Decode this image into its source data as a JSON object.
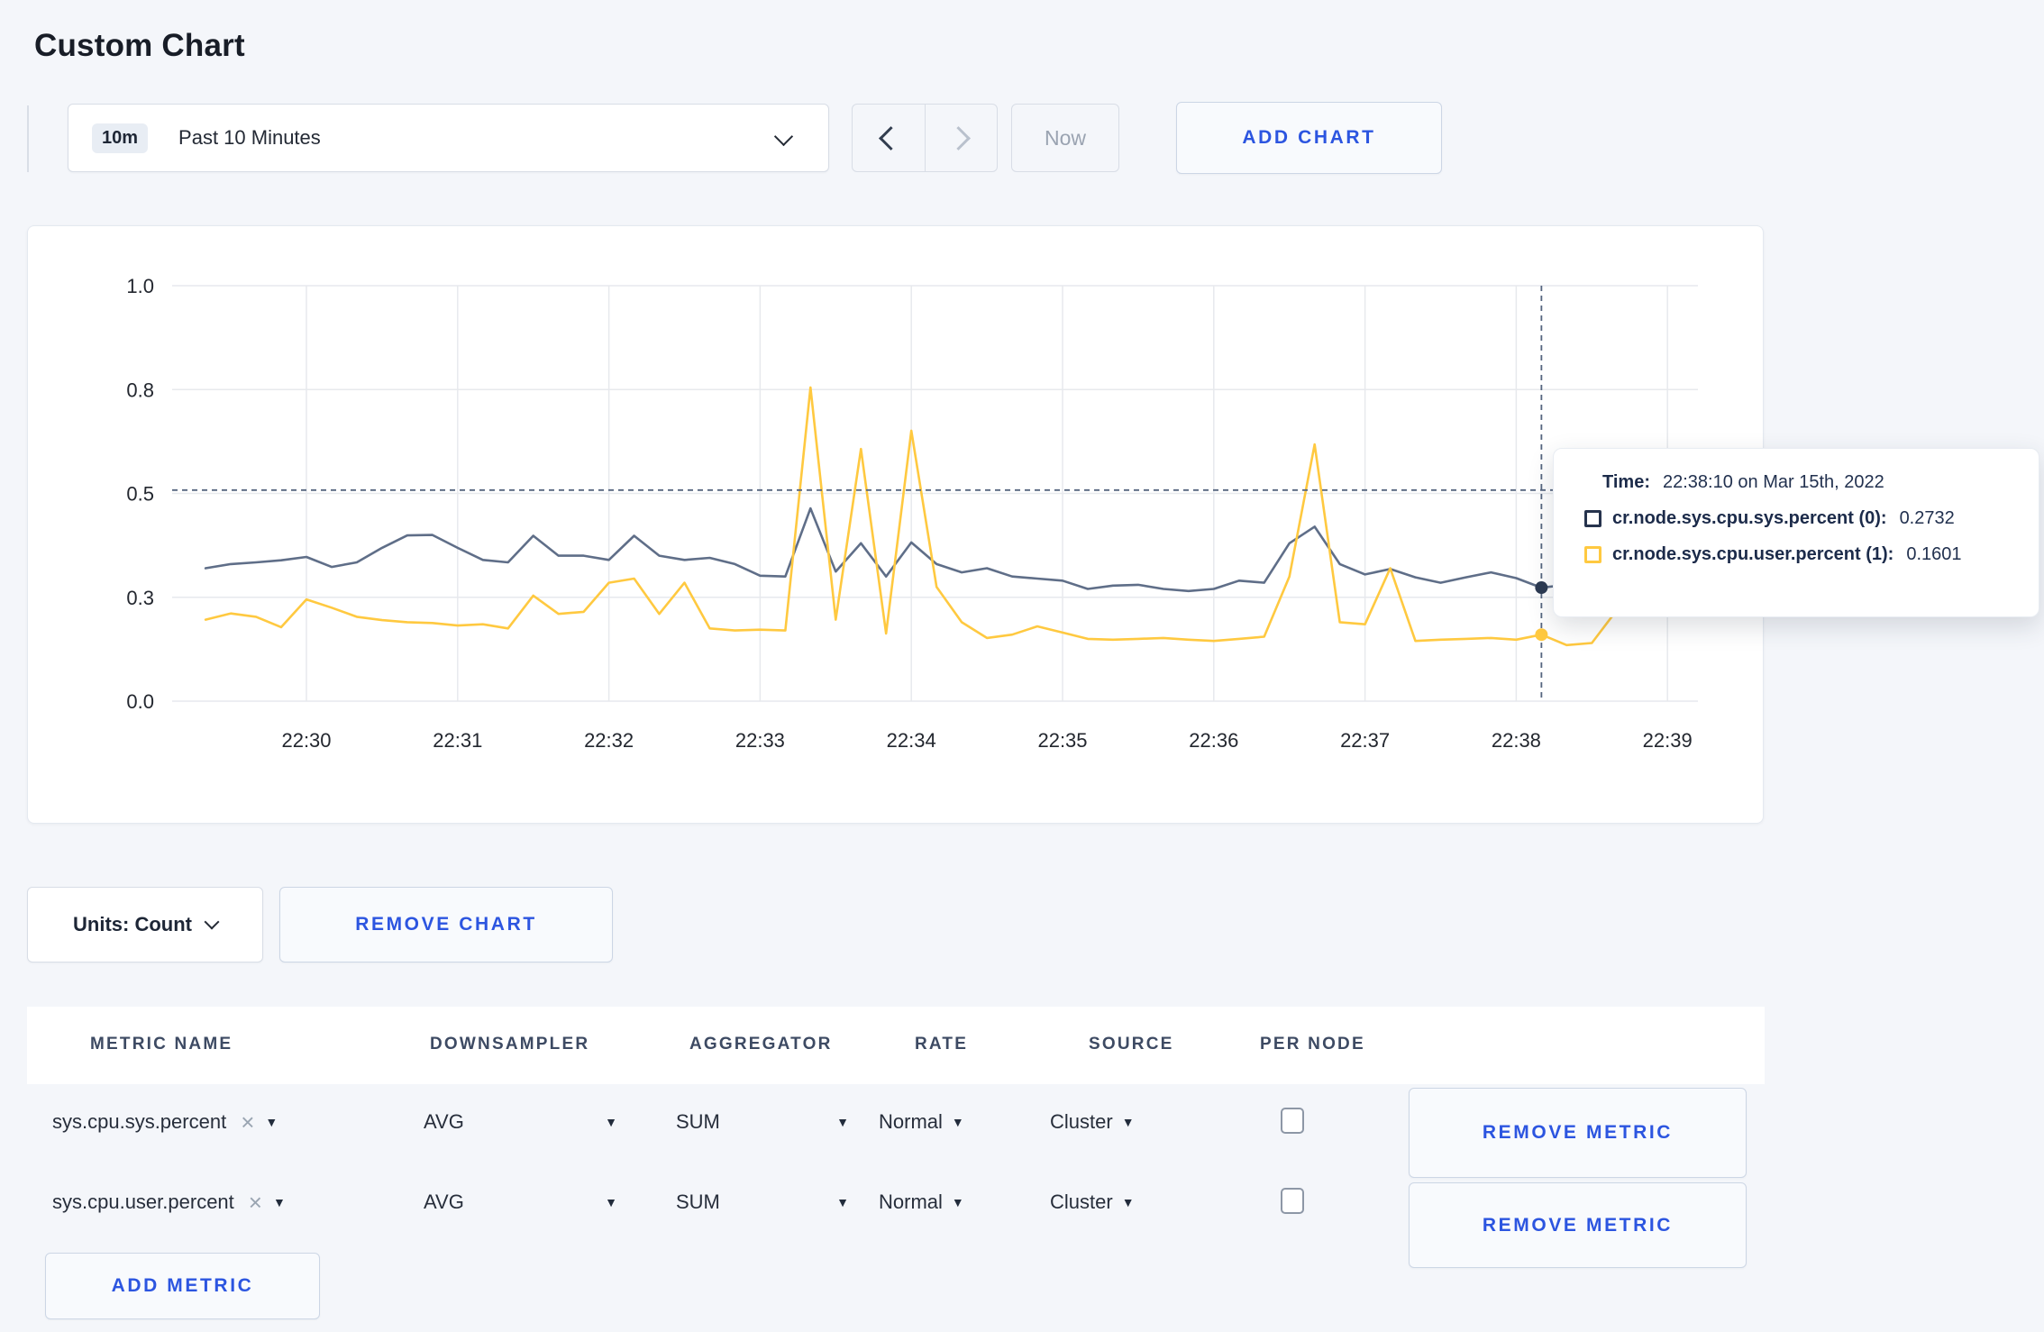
{
  "page": {
    "title": "Custom Chart",
    "background": "#f4f6fa",
    "accent_blue": "#2c55e0"
  },
  "icons": {
    "clear": "×",
    "caret": "▼"
  },
  "toolbar": {
    "time_range": {
      "badge": "10m",
      "label": "Past 10 Minutes"
    },
    "prev_icon": "chevron-left-icon",
    "next_icon": "chevron-right-icon",
    "now_label": "Now",
    "add_chart_label": "ADD CHART"
  },
  "chart_data": {
    "type": "line",
    "title": "",
    "grid": true,
    "ylim": [
      0,
      1
    ],
    "ytick_labels": [
      "0.0",
      "0.3",
      "0.5",
      "0.8",
      "1.0"
    ],
    "ytick_values": [
      0,
      0.25,
      0.5,
      0.75,
      1.0
    ],
    "xticks": [
      "22:30",
      "22:31",
      "22:32",
      "22:33",
      "22:34",
      "22:35",
      "22:36",
      "22:37",
      "22:38",
      "22:39"
    ],
    "x": [
      "22:29:20",
      "22:29:30",
      "22:29:40",
      "22:29:50",
      "22:30:00",
      "22:30:10",
      "22:30:20",
      "22:30:30",
      "22:30:40",
      "22:30:50",
      "22:31:00",
      "22:31:10",
      "22:31:20",
      "22:31:30",
      "22:31:40",
      "22:31:50",
      "22:32:00",
      "22:32:10",
      "22:32:20",
      "22:32:30",
      "22:32:40",
      "22:32:50",
      "22:33:00",
      "22:33:10",
      "22:33:20",
      "22:33:30",
      "22:33:40",
      "22:33:50",
      "22:34:00",
      "22:34:10",
      "22:34:20",
      "22:34:30",
      "22:34:40",
      "22:34:50",
      "22:35:00",
      "22:35:10",
      "22:35:20",
      "22:35:30",
      "22:35:40",
      "22:35:50",
      "22:36:00",
      "22:36:10",
      "22:36:20",
      "22:36:30",
      "22:36:40",
      "22:36:50",
      "22:37:00",
      "22:37:10",
      "22:37:20",
      "22:37:30",
      "22:37:40",
      "22:37:50",
      "22:38:00",
      "22:38:10",
      "22:38:20",
      "22:38:30",
      "22:38:40",
      "22:38:50",
      "22:39:00",
      "22:39:10"
    ],
    "series": [
      {
        "name": "cr.node.sys.cpu.sys.percent",
        "color": "#5f6e88",
        "point_color": "#2c3a52",
        "values": [
          0.32,
          0.33,
          0.334,
          0.339,
          0.347,
          0.323,
          0.334,
          0.369,
          0.399,
          0.4,
          0.369,
          0.34,
          0.334,
          0.398,
          0.35,
          0.35,
          0.34,
          0.398,
          0.35,
          0.34,
          0.345,
          0.33,
          0.302,
          0.3,
          0.464,
          0.312,
          0.38,
          0.3,
          0.382,
          0.33,
          0.31,
          0.32,
          0.3,
          0.295,
          0.29,
          0.27,
          0.278,
          0.28,
          0.27,
          0.265,
          0.27,
          0.29,
          0.285,
          0.38,
          0.42,
          0.33,
          0.305,
          0.318,
          0.298,
          0.285,
          0.298,
          0.31,
          0.296,
          0.2732,
          0.28,
          0.285,
          0.28,
          0.3,
          0.285,
          0.29
        ]
      },
      {
        "name": "cr.node.sys.cpu.user.percent",
        "color": "#ffc940",
        "point_color": "#ffc940",
        "values": [
          0.196,
          0.211,
          0.203,
          0.178,
          0.245,
          0.225,
          0.203,
          0.195,
          0.19,
          0.188,
          0.182,
          0.185,
          0.175,
          0.254,
          0.21,
          0.215,
          0.285,
          0.295,
          0.21,
          0.285,
          0.175,
          0.17,
          0.172,
          0.17,
          0.755,
          0.196,
          0.607,
          0.163,
          0.651,
          0.275,
          0.19,
          0.152,
          0.16,
          0.18,
          0.165,
          0.15,
          0.148,
          0.15,
          0.152,
          0.148,
          0.145,
          0.15,
          0.155,
          0.3,
          0.618,
          0.19,
          0.185,
          0.32,
          0.145,
          0.148,
          0.15,
          0.152,
          0.148,
          0.1601,
          0.135,
          0.14,
          0.22,
          0.28,
          0.24,
          0.26
        ]
      }
    ],
    "legend_position": "tooltip-only",
    "crosshair": {
      "time": "22:38:10",
      "hline_value": 0.508,
      "points": [
        {
          "series": 0,
          "value": 0.2732
        },
        {
          "series": 1,
          "value": 0.1601
        }
      ]
    }
  },
  "tooltip": {
    "time_label": "Time:",
    "time_value": "22:38:10 on Mar 15th, 2022",
    "series": [
      {
        "label": "cr.node.sys.cpu.sys.percent (0):",
        "value": "0.2732",
        "color": "#26334d"
      },
      {
        "label": "cr.node.sys.cpu.user.percent (1):",
        "value": "0.1601",
        "color": "#ffc940"
      }
    ]
  },
  "chart_controls": {
    "units_label": "Units: Count",
    "remove_chart_label": "REMOVE CHART"
  },
  "metrics_table": {
    "headers": [
      "METRIC NAME",
      "DOWNSAMPLER",
      "AGGREGATOR",
      "RATE",
      "SOURCE",
      "PER NODE"
    ],
    "rows": [
      {
        "metric": "sys.cpu.sys.percent",
        "downsampler": "AVG",
        "aggregator": "SUM",
        "rate": "Normal",
        "source": "Cluster",
        "per_node": false
      },
      {
        "metric": "sys.cpu.user.percent",
        "downsampler": "AVG",
        "aggregator": "SUM",
        "rate": "Normal",
        "source": "Cluster",
        "per_node": false
      }
    ],
    "remove_metric_label": "REMOVE METRIC",
    "add_metric_label": "ADD METRIC"
  }
}
